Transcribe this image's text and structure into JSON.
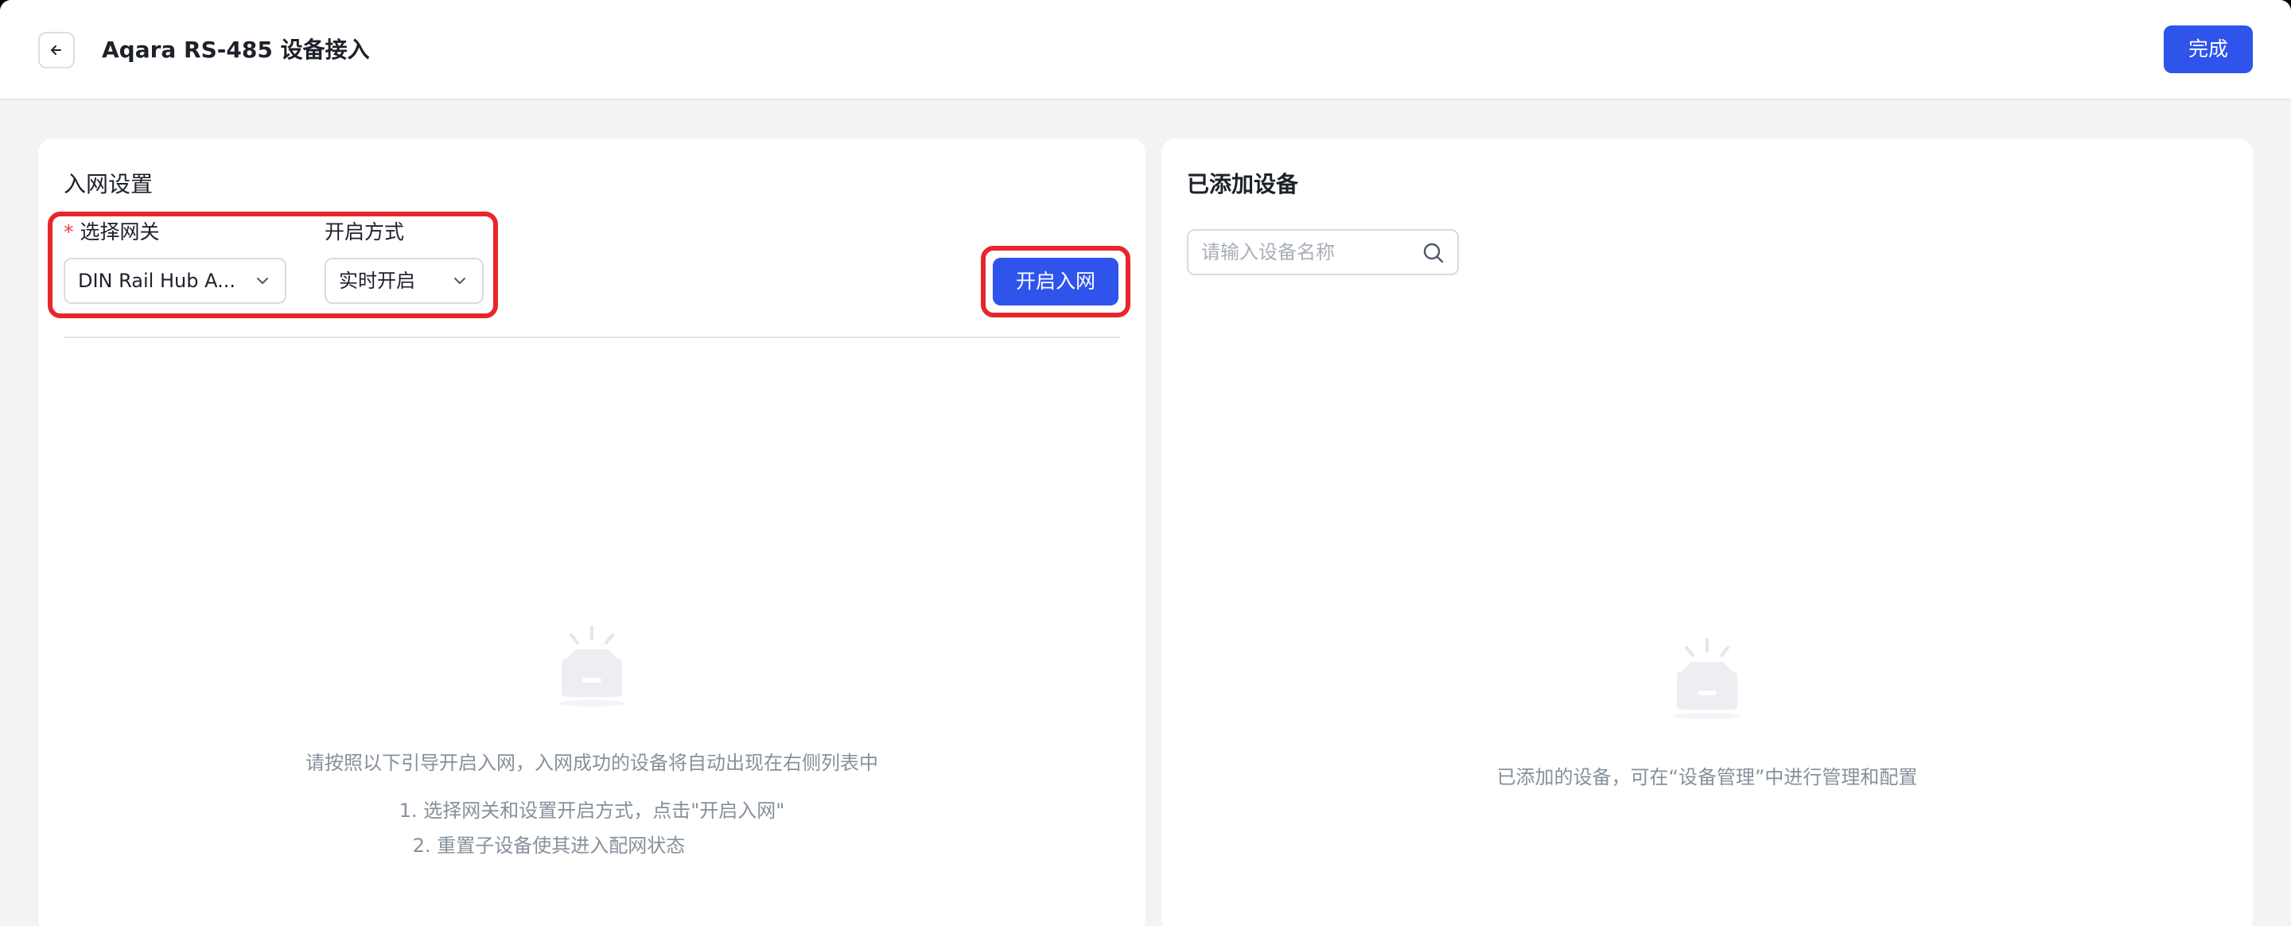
{
  "header": {
    "title": "Aqara RS-485 设备接入",
    "done_label": "完成"
  },
  "left_panel": {
    "title": "入网设置",
    "gateway": {
      "label": "选择网关",
      "required_mark": "*",
      "value": "DIN Rail Hub A..."
    },
    "mode": {
      "label": "开启方式",
      "value": "实时开启"
    },
    "start_button": "开启入网",
    "empty_state": {
      "message": "请按照以下引导开启入网，入网成功的设备将自动出现在右侧列表中",
      "steps": [
        "1. 选择网关和设置开启方式，点击\"开启入网\"",
        "2. 重置子设备使其进入配网状态"
      ]
    }
  },
  "right_panel": {
    "title": "已添加设备",
    "search": {
      "placeholder": "请输入设备名称",
      "value": ""
    },
    "empty_state": {
      "message": "已添加的设备，可在“设备管理”中进行管理和配置"
    }
  },
  "colors": {
    "primary": "#2f54eb",
    "highlight": "#e7262b",
    "required": "#f53f3f",
    "muted_text": "#86909c",
    "background": "#f2f3f5"
  },
  "icons": {
    "back": "arrow-left-icon",
    "chevron": "chevron-down-icon",
    "search": "search-icon",
    "empty": "empty-box-icon"
  }
}
